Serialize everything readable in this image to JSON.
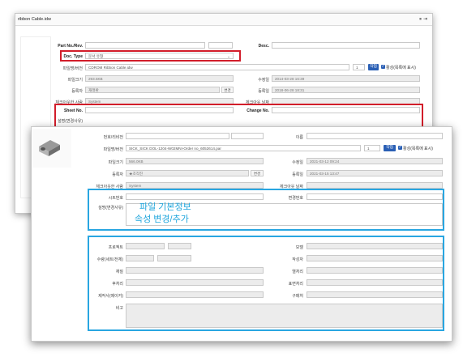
{
  "back": {
    "title": "ribbon Cable.idw",
    "titlebar_icons": [
      "pin-icon",
      "close-icon"
    ],
    "labels": {
      "part_no": "Part No./Rev.",
      "desc": "Desc.",
      "doc_type": "Doc. Type",
      "file_rev": "파일명/버전",
      "file_size": "파일크기",
      "modified": "수정일",
      "registrant": "등록자",
      "registered": "등록일",
      "checkout_user": "체크아웃한 사람",
      "checkout_date": "체크아웃 날짜",
      "sheet_no": "Sheet No.",
      "change_no": "Change No.",
      "description_change": "설명(변경사유)"
    },
    "values": {
      "doc_type": "문서 유형",
      "file_name": "CDROM Ribbon Cable.idw",
      "version": "1",
      "file_size": "293.5KB",
      "modified": "2014-03-28 16:39",
      "registrant": "재래환",
      "registered": "2018-06-28 18:31",
      "checkout_user": "System"
    },
    "buttons": {
      "work": "작업",
      "change": "변경"
    },
    "checkbox_label": "활성(목록에 표시)"
  },
  "front": {
    "labels": {
      "number_rev": "번호/리비전",
      "name": "이름",
      "file_rev": "파일명/버전",
      "file_size": "파일크기",
      "modified": "수정일",
      "registrant": "등록자",
      "registered": "등록일",
      "checkout_user": "체크아웃한 사람",
      "checkout_date": "체크아웃 날짜",
      "sheet_no": "시트번호",
      "change_no": "변경번호",
      "description_change": "설명(변경사유)",
      "project": "프로젝트",
      "model": "모델",
      "quantity": "수량(세트/전체)",
      "author": "작성자",
      "material": "재질",
      "heat_treatment": "열처리",
      "post_processing": "후처리",
      "surface_treatment": "표면처리",
      "maker": "제작사(메이커)",
      "purchaser": "구매처",
      "remarks": "비고"
    },
    "values": {
      "file_name": "SICK_SICK DOL-1204-W02MNI-Order no_6052614.par",
      "version": "1",
      "file_size": "566.0KB",
      "modified": "2021-03-12 09:24",
      "registrant": "★조작진",
      "registered": "2021-03-15 13:47",
      "checkout_user": "System"
    },
    "buttons": {
      "work": "작업",
      "change": "변경"
    },
    "checkbox_label": "활성(목록에 표시)"
  },
  "annotation": {
    "line1": "파일 기본정보",
    "line2": "속성 변경/추가"
  },
  "colors": {
    "highlight_red": "#d21d2a",
    "highlight_blue": "#29a6e1",
    "button_blue": "#2a5fb5"
  }
}
